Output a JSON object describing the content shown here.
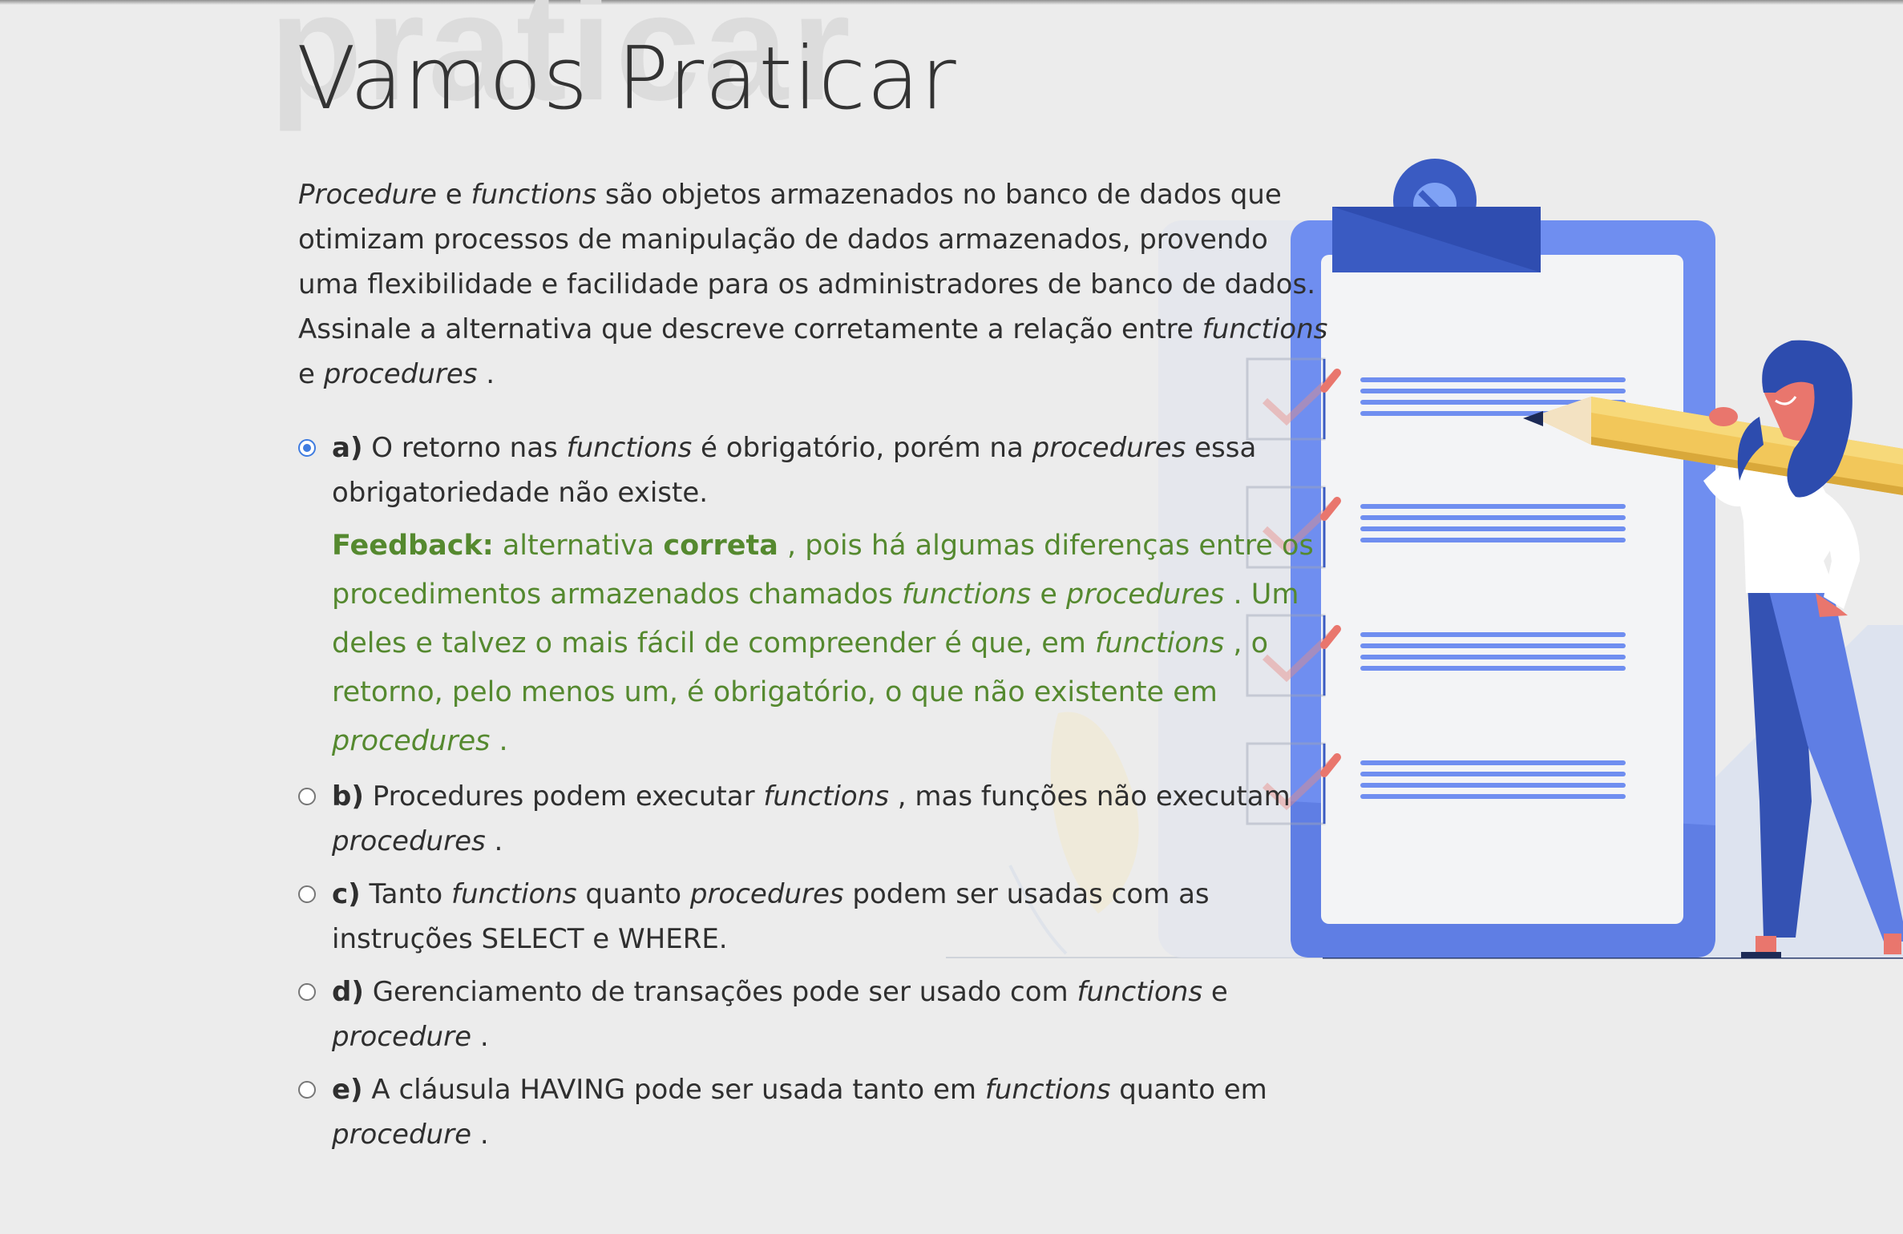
{
  "page": {
    "watermark": "praticar",
    "title": "Vamos Praticar"
  },
  "question": {
    "t1": "Procedure",
    "t2": " e ",
    "t3": "functions",
    "t4": " são objetos armazenados no banco de dados que otimizam processos de manipulação de dados armazenados, provendo uma flexibilidade e facilidade para os administradores de banco de dados. Assinale a alternativa que descreve corretamente a relação entre ",
    "t5": "functions",
    "t6": " e ",
    "t7": "procedures",
    "t8": " ."
  },
  "options": [
    {
      "letter": "a)",
      "selected": true,
      "p1": " O retorno nas ",
      "p2": "functions",
      "p3": " é obrigatório, porém na ",
      "p4": "procedures",
      "p5": " essa obrigatoriedade não existe."
    },
    {
      "letter": "b)",
      "selected": false,
      "p1": " Procedures podem executar ",
      "p2": "functions",
      "p3": " , mas funções não executam ",
      "p4": "procedures",
      "p5": " ."
    },
    {
      "letter": "c)",
      "selected": false,
      "p1": " Tanto ",
      "p2": "functions",
      "p3": " quanto ",
      "p4": "procedures",
      "p5": " podem ser usadas com as instruções SELECT e WHERE."
    },
    {
      "letter": "d)",
      "selected": false,
      "p1": " Gerenciamento de transações pode ser usado com ",
      "p2": "functions",
      "p3": " e ",
      "p4": "procedure",
      "p5": " ."
    },
    {
      "letter": "e)",
      "selected": false,
      "p1": " A cláusula HAVING pode ser usada tanto em ",
      "p2": "functions",
      "p3": " quanto em ",
      "p4": "procedure",
      "p5": " ."
    }
  ],
  "feedback": {
    "label": "Feedback:",
    "f1": " alternativa ",
    "f2": "correta",
    "f3": " , pois há algumas diferenças entre os procedimentos armazenados chamados ",
    "f4": "functions",
    "f5": " e ",
    "f6": "procedures",
    "f7": " . Um deles e talvez o mais fácil de compreender é que, em ",
    "f8": "functions",
    "f9": " , o retorno, pelo menos um, é obrigatório, o que não existente em ",
    "f10": "procedures",
    "f11": " ."
  },
  "colors": {
    "background": "#ececec",
    "feedback_green": "#55892f",
    "radio_selected": "#3f7ce0",
    "clipboard_blue": "#6f8ef0",
    "clipboard_dark": "#3a5bc2",
    "pencil_yellow": "#f2c75a",
    "woman_pants": "#3452b3",
    "woman_hair": "#2d4cae"
  }
}
